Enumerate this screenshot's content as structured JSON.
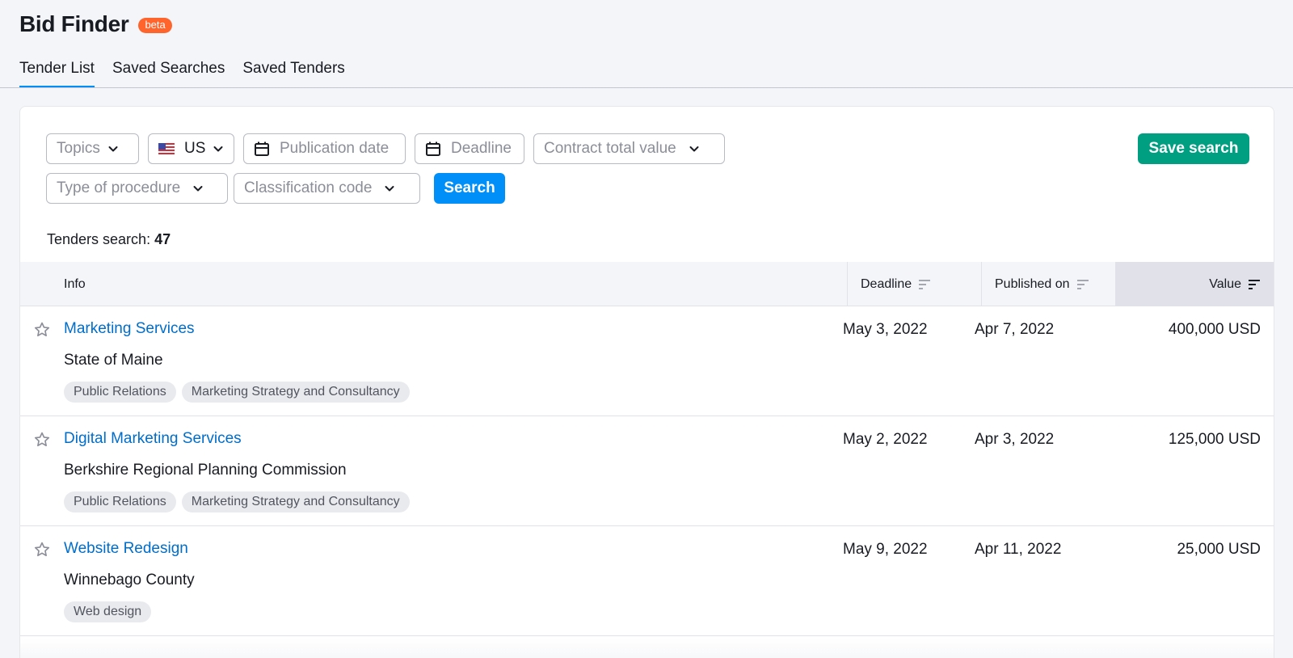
{
  "app": {
    "title": "Bid Finder",
    "badge": "beta"
  },
  "tabs": [
    {
      "label": "Tender List",
      "active": true
    },
    {
      "label": "Saved Searches",
      "active": false
    },
    {
      "label": "Saved Tenders",
      "active": false
    }
  ],
  "filters": {
    "topics": "Topics",
    "country": "US",
    "publication_date": "Publication date",
    "deadline": "Deadline",
    "contract_value": "Contract total value",
    "procedure": "Type of procedure",
    "classification": "Classification code"
  },
  "buttons": {
    "search": "Search",
    "save_search": "Save search"
  },
  "results": {
    "label": "Tenders search:",
    "count": "47"
  },
  "table": {
    "headers": {
      "info": "Info",
      "deadline": "Deadline",
      "published": "Published on",
      "value": "Value"
    },
    "rows": [
      {
        "title": "Marketing Services",
        "org": "State of Maine",
        "tags": [
          "Public Relations",
          "Marketing Strategy and Consultancy"
        ],
        "deadline": "May 3, 2022",
        "published": "Apr 7, 2022",
        "value": "400,000 USD"
      },
      {
        "title": "Digital Marketing Services",
        "org": "Berkshire Regional Planning Commission",
        "tags": [
          "Public Relations",
          "Marketing Strategy and Consultancy"
        ],
        "deadline": "May 2, 2022",
        "published": "Apr 3, 2022",
        "value": "125,000 USD"
      },
      {
        "title": "Website Redesign",
        "org": "Winnebago County",
        "tags": [
          "Web design"
        ],
        "deadline": "May 9, 2022",
        "published": "Apr 11, 2022",
        "value": "25,000 USD"
      }
    ]
  },
  "colors": {
    "accent": "#008ff8",
    "save": "#009f81",
    "badge": "#ff642d",
    "link": "#006dca"
  },
  "icons": [
    "chevron-down-icon",
    "us-flag-icon",
    "calendar-icon",
    "sort-icon",
    "star-icon"
  ]
}
